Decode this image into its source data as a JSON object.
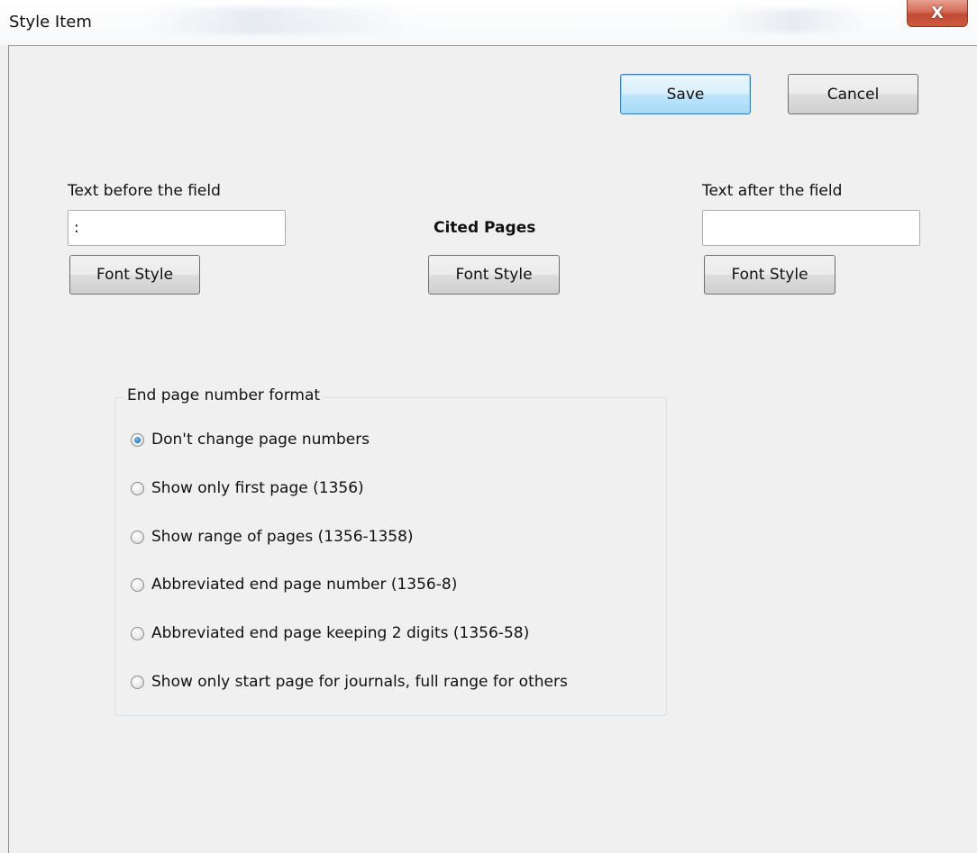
{
  "window": {
    "title": "Style Item",
    "close_glyph": "X"
  },
  "actions": {
    "save_label": "Save",
    "cancel_label": "Cancel"
  },
  "fields": {
    "before": {
      "label": "Text before the field",
      "value": ":",
      "font_style_label": "Font Style"
    },
    "field_name": {
      "label": "Cited Pages",
      "font_style_label": "Font Style"
    },
    "after": {
      "label": "Text after the field",
      "value": "",
      "font_style_label": "Font Style"
    }
  },
  "end_page_format": {
    "legend": "End page number format",
    "selected_index": 0,
    "options": [
      "Don't change page numbers",
      "Show only first page (1356)",
      "Show range of pages (1356-1358)",
      "Abbreviated end page number (1356-8)",
      "Abbreviated end page keeping 2 digits (1356-58)",
      "Show only start page for journals, full range for others"
    ]
  },
  "colors": {
    "close_button": "#c9533a",
    "default_button_border": "#3c7fb1",
    "window_bg": "#f0f0f0"
  }
}
